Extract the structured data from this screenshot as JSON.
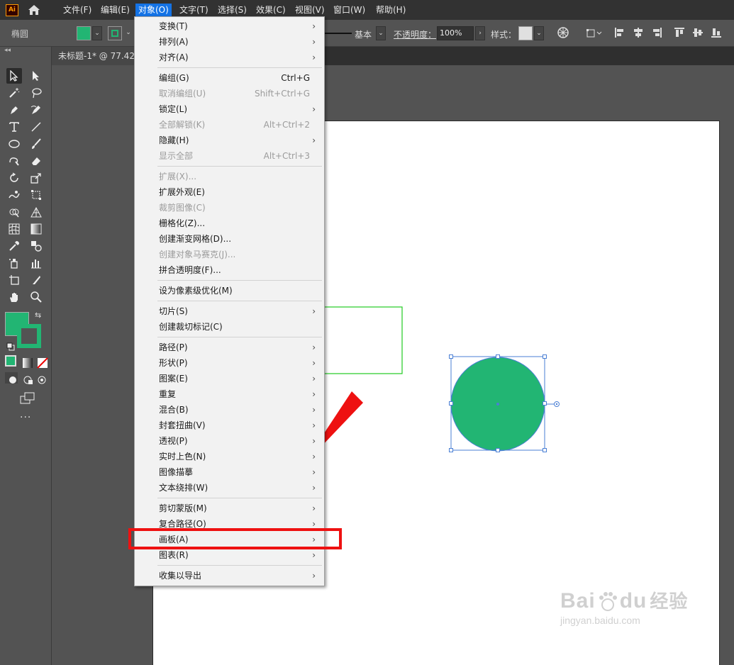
{
  "app": {
    "logo_text": "Ai"
  },
  "menubar": {
    "items": [
      {
        "label": "文件(F)",
        "active": false
      },
      {
        "label": "编辑(E)",
        "active": false
      },
      {
        "label": "对象(O)",
        "active": true
      },
      {
        "label": "文字(T)",
        "active": false
      },
      {
        "label": "选择(S)",
        "active": false
      },
      {
        "label": "效果(C)",
        "active": false
      },
      {
        "label": "视图(V)",
        "active": false
      },
      {
        "label": "窗口(W)",
        "active": false
      },
      {
        "label": "帮助(H)",
        "active": false
      }
    ]
  },
  "controlbar": {
    "tool_name": "椭圆",
    "fill_color": "#22b573",
    "stroke_color": "#22b573",
    "stroke_style": "基本",
    "opacity_label": "不透明度：",
    "opacity_value": "100%",
    "style_label": "样式："
  },
  "document": {
    "tab_title": "未标题-1* @ 77.42"
  },
  "toolbar": {
    "fill_color": "#22b573",
    "stroke_color": "#22b573",
    "more": "···"
  },
  "object_menu": {
    "groups": [
      [
        {
          "label": "变换(T)",
          "shortcut": "",
          "submenu": true,
          "disabled": false
        },
        {
          "label": "排列(A)",
          "shortcut": "",
          "submenu": true,
          "disabled": false
        },
        {
          "label": "对齐(A)",
          "shortcut": "",
          "submenu": true,
          "disabled": false
        }
      ],
      [
        {
          "label": "编组(G)",
          "shortcut": "Ctrl+G",
          "submenu": false,
          "disabled": false
        },
        {
          "label": "取消编组(U)",
          "shortcut": "Shift+Ctrl+G",
          "submenu": false,
          "disabled": true
        },
        {
          "label": "锁定(L)",
          "shortcut": "",
          "submenu": true,
          "disabled": false
        },
        {
          "label": "全部解锁(K)",
          "shortcut": "Alt+Ctrl+2",
          "submenu": false,
          "disabled": true
        },
        {
          "label": "隐藏(H)",
          "shortcut": "",
          "submenu": true,
          "disabled": false
        },
        {
          "label": "显示全部",
          "shortcut": "Alt+Ctrl+3",
          "submenu": false,
          "disabled": true
        }
      ],
      [
        {
          "label": "扩展(X)...",
          "shortcut": "",
          "submenu": false,
          "disabled": true
        },
        {
          "label": "扩展外观(E)",
          "shortcut": "",
          "submenu": false,
          "disabled": false
        },
        {
          "label": "裁剪图像(C)",
          "shortcut": "",
          "submenu": false,
          "disabled": true
        },
        {
          "label": "栅格化(Z)...",
          "shortcut": "",
          "submenu": false,
          "disabled": false
        },
        {
          "label": "创建渐变网格(D)...",
          "shortcut": "",
          "submenu": false,
          "disabled": false
        },
        {
          "label": "创建对象马赛克(J)...",
          "shortcut": "",
          "submenu": false,
          "disabled": true
        },
        {
          "label": "拼合透明度(F)...",
          "shortcut": "",
          "submenu": false,
          "disabled": false
        }
      ],
      [
        {
          "label": "设为像素级优化(M)",
          "shortcut": "",
          "submenu": false,
          "disabled": false
        }
      ],
      [
        {
          "label": "切片(S)",
          "shortcut": "",
          "submenu": true,
          "disabled": false
        },
        {
          "label": "创建裁切标记(C)",
          "shortcut": "",
          "submenu": false,
          "disabled": false
        }
      ],
      [
        {
          "label": "路径(P)",
          "shortcut": "",
          "submenu": true,
          "disabled": false
        },
        {
          "label": "形状(P)",
          "shortcut": "",
          "submenu": true,
          "disabled": false
        },
        {
          "label": "图案(E)",
          "shortcut": "",
          "submenu": true,
          "disabled": false
        },
        {
          "label": "重复",
          "shortcut": "",
          "submenu": true,
          "disabled": false
        },
        {
          "label": "混合(B)",
          "shortcut": "",
          "submenu": true,
          "disabled": false
        },
        {
          "label": "封套扭曲(V)",
          "shortcut": "",
          "submenu": true,
          "disabled": false
        },
        {
          "label": "透视(P)",
          "shortcut": "",
          "submenu": true,
          "disabled": false
        },
        {
          "label": "实时上色(N)",
          "shortcut": "",
          "submenu": true,
          "disabled": false
        },
        {
          "label": "图像描摹",
          "shortcut": "",
          "submenu": true,
          "disabled": false
        },
        {
          "label": "文本绕排(W)",
          "shortcut": "",
          "submenu": true,
          "disabled": false
        }
      ],
      [
        {
          "label": "剪切蒙版(M)",
          "shortcut": "",
          "submenu": true,
          "disabled": false
        },
        {
          "label": "复合路径(O)",
          "shortcut": "",
          "submenu": true,
          "disabled": false
        },
        {
          "label": "画板(A)",
          "shortcut": "",
          "submenu": true,
          "disabled": false
        },
        {
          "label": "图表(R)",
          "shortcut": "",
          "submenu": true,
          "disabled": false
        }
      ],
      [
        {
          "label": "收集以导出",
          "shortcut": "",
          "submenu": true,
          "disabled": false
        }
      ]
    ]
  },
  "canvas": {
    "circle_fill": "#22b573",
    "selection_color": "#4a7fd4",
    "rect_stroke": "#22cc22"
  },
  "annotation": {
    "color": "#ee1111"
  },
  "watermark": {
    "brand": "Bai",
    "brand2": "du",
    "cn": "经验",
    "url": "jingyan.baidu.com"
  }
}
